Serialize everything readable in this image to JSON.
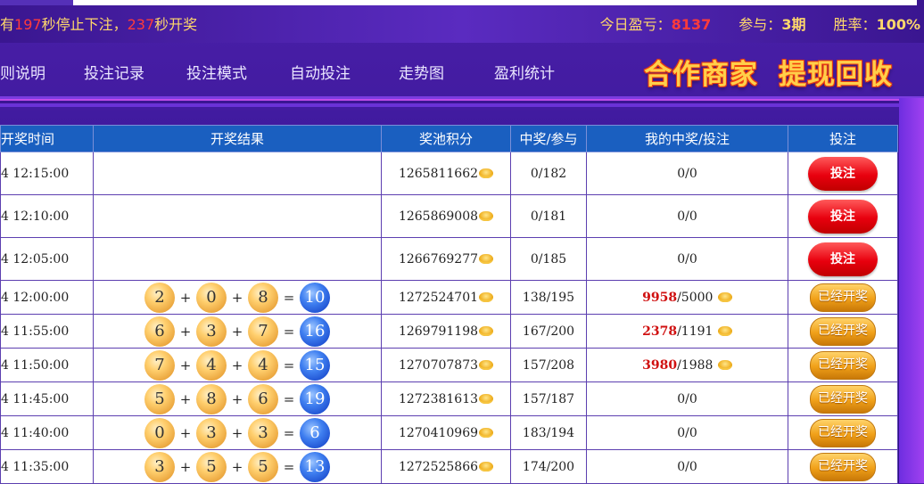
{
  "topbar": {
    "countdown": {
      "prefix": "有",
      "stop_seconds": "197",
      "mid": "秒停止下注，",
      "draw_seconds": "237",
      "suffix": "秒开奖"
    },
    "today_profit_label": "今日盈亏：",
    "today_profit_value": "8137",
    "participate_label": "参与：",
    "participate_value": "3期",
    "winrate_label": "胜率：",
    "winrate_value": "100%"
  },
  "nav": {
    "items": [
      "则说明",
      "投注记录",
      "投注模式",
      "自动投注",
      "走势图",
      "盈利统计"
    ],
    "promo_1": "合作商家",
    "promo_2": "提现回收"
  },
  "table": {
    "headers": [
      "开奖时间",
      "开奖结果",
      "奖池积分",
      "中奖/参与",
      "我的中奖/投注",
      "投注"
    ],
    "bet_label": "投注",
    "done_label": "已经开奖",
    "rows": [
      {
        "time": "4 12:15:00",
        "pool": "1265811662",
        "ratio": "0/182",
        "mine": "0/0",
        "status": "bet"
      },
      {
        "time": "4 12:10:00",
        "pool": "1265869008",
        "ratio": "0/181",
        "mine": "0/0",
        "status": "bet"
      },
      {
        "time": "4 12:05:00",
        "pool": "1266769277",
        "ratio": "0/185",
        "mine": "0/0",
        "status": "bet"
      },
      {
        "time": "4 12:00:00",
        "nums": [
          "2",
          "0",
          "8"
        ],
        "sum": "10",
        "pool": "1272524701",
        "ratio": "138/195",
        "mine_win": "9958",
        "mine_bet": "/5000",
        "status": "done"
      },
      {
        "time": "4 11:55:00",
        "nums": [
          "6",
          "3",
          "7"
        ],
        "sum": "16",
        "pool": "1269791198",
        "ratio": "167/200",
        "mine_win": "2378",
        "mine_bet": "/1191",
        "status": "done"
      },
      {
        "time": "4 11:50:00",
        "nums": [
          "7",
          "4",
          "4"
        ],
        "sum": "15",
        "pool": "1270707873",
        "ratio": "157/208",
        "mine_win": "3980",
        "mine_bet": "/1988",
        "status": "done"
      },
      {
        "time": "4 11:45:00",
        "nums": [
          "5",
          "8",
          "6"
        ],
        "sum": "19",
        "pool": "1272381613",
        "ratio": "157/187",
        "mine": "0/0",
        "status": "done"
      },
      {
        "time": "4 11:40:00",
        "nums": [
          "0",
          "3",
          "3"
        ],
        "sum": "6",
        "pool": "1270410969",
        "ratio": "183/194",
        "mine": "0/0",
        "status": "done"
      },
      {
        "time": "4 11:35:00",
        "nums": [
          "3",
          "5",
          "5"
        ],
        "sum": "13",
        "pool": "1272525866",
        "ratio": "174/200",
        "mine": "0/0",
        "status": "done"
      }
    ]
  }
}
